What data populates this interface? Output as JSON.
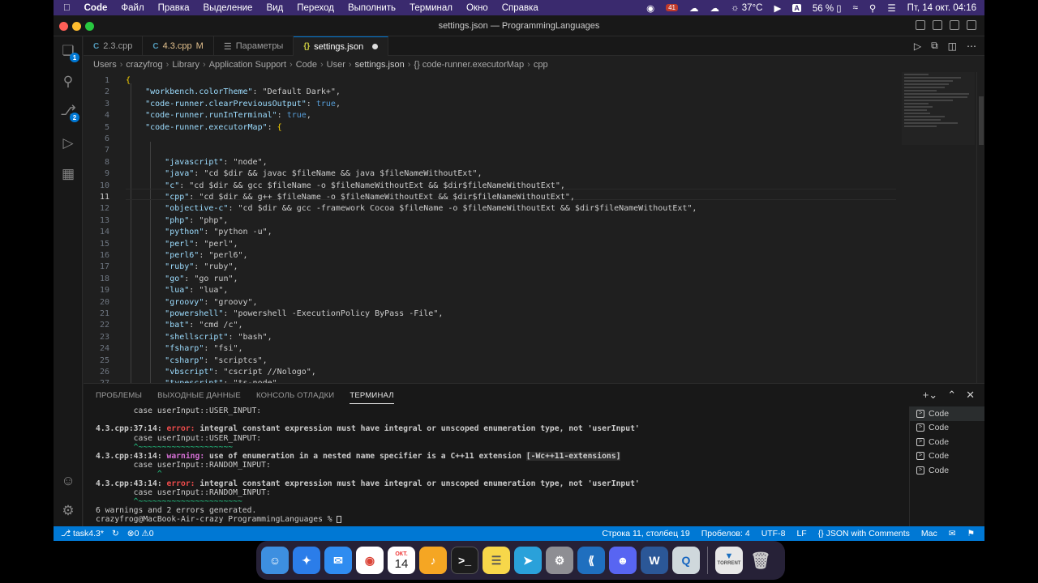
{
  "menubar": {
    "app": "Code",
    "items": [
      "Файл",
      "Правка",
      "Выделение",
      "Вид",
      "Переход",
      "Выполнить",
      "Терминал",
      "Окно",
      "Справка"
    ],
    "badge": "41",
    "temp": "37°C",
    "input_lang": "A",
    "battery": "56 %",
    "clock": "Пт, 14 окт. 04:16"
  },
  "window": {
    "title": "settings.json — ProgrammingLanguages"
  },
  "activity": {
    "scm_badge": "1",
    "debug_badge": "2"
  },
  "tabs": [
    {
      "label": "2.3.cpp",
      "modified": ""
    },
    {
      "label": "4.3.cpp",
      "modified": "M"
    },
    {
      "label": "Параметры",
      "modified": ""
    },
    {
      "label": "settings.json",
      "modified": ""
    }
  ],
  "breadcrumb": [
    "Users",
    "crazyfrog",
    "Library",
    "Application Support",
    "Code",
    "User",
    "settings.json",
    "{} code-runner.executorMap",
    "cpp"
  ],
  "editor": {
    "current_line": 11,
    "lines": [
      {
        "n": "1",
        "t": "{"
      },
      {
        "n": "2",
        "t": "    \"workbench.colorTheme\": \"Default Dark+\","
      },
      {
        "n": "3",
        "t": "    \"code-runner.clearPreviousOutput\": true,"
      },
      {
        "n": "4",
        "t": "    \"code-runner.runInTerminal\": true,"
      },
      {
        "n": "5",
        "t": "    \"code-runner.executorMap\": {"
      },
      {
        "n": "6",
        "t": ""
      },
      {
        "n": "7",
        "t": ""
      },
      {
        "n": "8",
        "t": "        \"javascript\": \"node\","
      },
      {
        "n": "9",
        "t": "        \"java\": \"cd $dir && javac $fileName && java $fileNameWithoutExt\","
      },
      {
        "n": "10",
        "t": "        \"c\": \"cd $dir && gcc $fileName -o $fileNameWithoutExt && $dir$fileNameWithoutExt\","
      },
      {
        "n": "11",
        "t": "        \"cpp\": \"cd $dir && g++ $fileName -o $fileNameWithoutExt && $dir$fileNameWithoutExt\","
      },
      {
        "n": "12",
        "t": "        \"objective-c\": \"cd $dir && gcc -framework Cocoa $fileName -o $fileNameWithoutExt && $dir$fileNameWithoutExt\","
      },
      {
        "n": "13",
        "t": "        \"php\": \"php\","
      },
      {
        "n": "14",
        "t": "        \"python\": \"python -u\","
      },
      {
        "n": "15",
        "t": "        \"perl\": \"perl\","
      },
      {
        "n": "16",
        "t": "        \"perl6\": \"perl6\","
      },
      {
        "n": "17",
        "t": "        \"ruby\": \"ruby\","
      },
      {
        "n": "18",
        "t": "        \"go\": \"go run\","
      },
      {
        "n": "19",
        "t": "        \"lua\": \"lua\","
      },
      {
        "n": "20",
        "t": "        \"groovy\": \"groovy\","
      },
      {
        "n": "21",
        "t": "        \"powershell\": \"powershell -ExecutionPolicy ByPass -File\","
      },
      {
        "n": "22",
        "t": "        \"bat\": \"cmd /c\","
      },
      {
        "n": "23",
        "t": "        \"shellscript\": \"bash\","
      },
      {
        "n": "24",
        "t": "        \"fsharp\": \"fsi\","
      },
      {
        "n": "25",
        "t": "        \"csharp\": \"scriptcs\","
      },
      {
        "n": "26",
        "t": "        \"vbscript\": \"cscript //Nologo\","
      },
      {
        "n": "27",
        "t": "        \"typescript\": \"ts-node\","
      }
    ]
  },
  "panel": {
    "tabs": [
      "ПРОБЛЕМЫ",
      "ВЫХОДНЫЕ ДАННЫЕ",
      "КОНСОЛЬ ОТЛАДКИ",
      "ТЕРМИНАЛ"
    ],
    "terminal": [
      {
        "a": "        case userInput::USER_INPUT:",
        "cls": ""
      },
      {
        "a": "",
        "cls": ""
      },
      {
        "a": "4.3.cpp:37:14: ",
        "e": "error: ",
        "r": "integral constant expression must have integral or unscoped enumeration type, not 'userInput'",
        "cls": "err"
      },
      {
        "a": "        case userInput::USER_INPUT:",
        "cls": ""
      },
      {
        "a": "        ^~~~~~~~~~~~~~~~~~~~~",
        "cls": "grn"
      },
      {
        "a": "4.3.cpp:43:14: ",
        "e": "warning: ",
        "r": "use of enumeration in a nested name specifier is a C++11 extension ",
        "x": "[-Wc++11-extensions]",
        "cls": "warn"
      },
      {
        "a": "        case userInput::RANDOM_INPUT:",
        "cls": ""
      },
      {
        "a": "             ^",
        "cls": "grn"
      },
      {
        "a": "4.3.cpp:43:14: ",
        "e": "error: ",
        "r": "integral constant expression must have integral or unscoped enumeration type, not 'userInput'",
        "cls": "err"
      },
      {
        "a": "        case userInput::RANDOM_INPUT:",
        "cls": ""
      },
      {
        "a": "        ^~~~~~~~~~~~~~~~~~~~~~~",
        "cls": "grn"
      },
      {
        "a": "6 warnings and 2 errors generated.",
        "cls": ""
      },
      {
        "a": "crazyfrog@MacBook-Air-crazy ProgrammingLanguages % ",
        "cls": "prompt"
      }
    ],
    "terminal_list": [
      "Code",
      "Code",
      "Code",
      "Code",
      "Code"
    ]
  },
  "status": {
    "branch": "task4.3*",
    "problems": "0",
    "warnings": "0",
    "position": "Строка 11, столбец 19",
    "spaces": "Пробелов: 4",
    "encoding": "UTF-8",
    "eol": "LF",
    "language": "JSON with Comments",
    "platform": "Mac"
  },
  "dock": {
    "calendar_month": "ОКТ.",
    "calendar_day": "14",
    "torrent_label": "TORRENT"
  },
  "colors": {
    "accent": "#0078d4",
    "menubar": "#3a2a6e",
    "error": "#f14c4c",
    "warning": "#d670d6"
  }
}
